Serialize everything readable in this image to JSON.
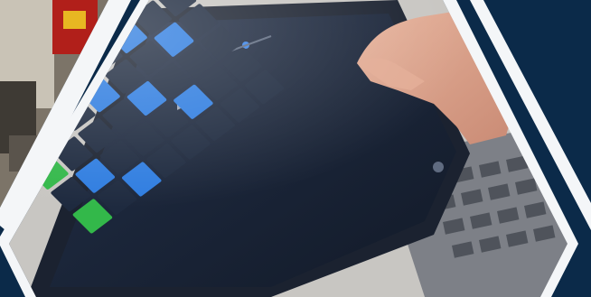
{
  "colors": {
    "navy": "#0b2a49",
    "white_stripe": "#f4f6f8",
    "tablet_frame": "#1b2230",
    "screen_bg": "#1a2436",
    "cell_dark": "#1e2a3f",
    "cell_blue": "#2f7de0",
    "cell_green": "#33b84a",
    "record_red": "#d8313a",
    "skin": "#d8a08a",
    "keyboard": "#8b8e94",
    "table": "#c9c2b8"
  },
  "photo": {
    "subject": "tablet-music-app-grid",
    "panels": [
      "left-photo-panel",
      "center-photo-panel",
      "right-navy-panel"
    ]
  },
  "grid": {
    "rows": 8,
    "cols": 8,
    "cells": [
      {
        "r": 0,
        "c": 5,
        "color": "blue"
      },
      {
        "r": 1,
        "c": 6,
        "color": "blue"
      },
      {
        "r": 2,
        "c": 4,
        "color": "blue"
      },
      {
        "r": 2,
        "c": 7,
        "color": "blue"
      },
      {
        "r": 3,
        "c": 5,
        "color": "blue"
      },
      {
        "r": 4,
        "c": 3,
        "color": "blue"
      },
      {
        "r": 4,
        "c": 6,
        "color": "blue"
      },
      {
        "r": 5,
        "c": 0,
        "color": "green"
      },
      {
        "r": 5,
        "c": 4,
        "color": "blue"
      },
      {
        "r": 6,
        "c": 1,
        "color": "blue"
      },
      {
        "r": 6,
        "c": 5,
        "color": "blue"
      },
      {
        "r": 7,
        "c": 2,
        "color": "blue"
      },
      {
        "r": 7,
        "c": 0,
        "color": "green"
      }
    ]
  }
}
